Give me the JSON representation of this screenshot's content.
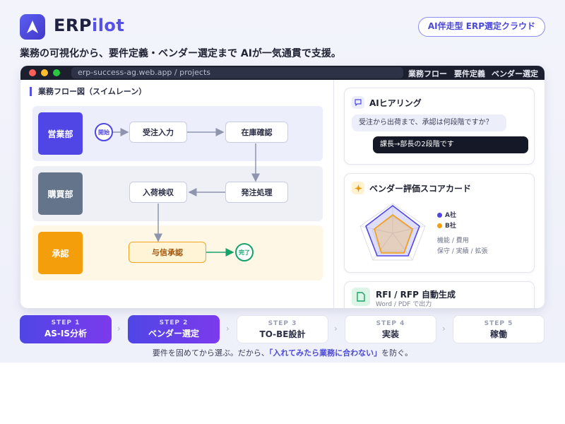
{
  "header": {
    "brand_prefix": "ERP",
    "brand_suffix": "ilot",
    "badge": "AI伴走型 ERP選定クラウド",
    "tagline": "業務の可視化から、要件定義・ベンダー選定まで AIが一気通貫で支援。"
  },
  "browser": {
    "url": "erp-success-ag.web.app / projects",
    "nav": [
      "業務フロー",
      "要件定義",
      "ベンダー選定"
    ]
  },
  "flow": {
    "title": "業務フロー図（スイムレーン）",
    "lanes": [
      {
        "label": "営業部",
        "color": "#4f46e5"
      },
      {
        "label": "購買部",
        "color": "#64748b"
      },
      {
        "label": "承認",
        "color": "#f59e0b"
      }
    ],
    "start_label": "開始",
    "end_label": "完了",
    "nodes": {
      "order_entry": "受注入力",
      "stock_check": "在庫確認",
      "purchase_order": "発注処理",
      "receiving": "入荷検収",
      "credit_approval": "与信承認"
    }
  },
  "ai_hearing": {
    "title": "AIヒアリング",
    "question": "受注から出荷まで、承認は何段階ですか？",
    "answer": "課長→部長の2段階です"
  },
  "scorecard": {
    "title": "ベンダー評価スコアカード",
    "legend": [
      {
        "name": "A社",
        "color": "#4f46e5"
      },
      {
        "name": "B社",
        "color": "#f59e0b"
      }
    ],
    "axes_line1": "機能 / 費用",
    "axes_line2": "保守 / 実績 / 拡張"
  },
  "rfp": {
    "title": "RFI / RFP 自動生成",
    "subtitle": "Word / PDF で出力"
  },
  "steps": [
    {
      "num": "STEP 1",
      "name": "AS-IS分析",
      "active": true
    },
    {
      "num": "STEP 2",
      "name": "ベンダー選定",
      "active": true
    },
    {
      "num": "STEP 3",
      "name": "TO-BE設計",
      "active": false
    },
    {
      "num": "STEP 4",
      "name": "実装",
      "active": false
    },
    {
      "num": "STEP 5",
      "name": "稼働",
      "active": false
    }
  ],
  "footer": {
    "text_before": "要件を固めてから選ぶ。だから、",
    "highlight": "「入れてみたら業務に合わない」",
    "text_after": "を防ぐ。"
  }
}
